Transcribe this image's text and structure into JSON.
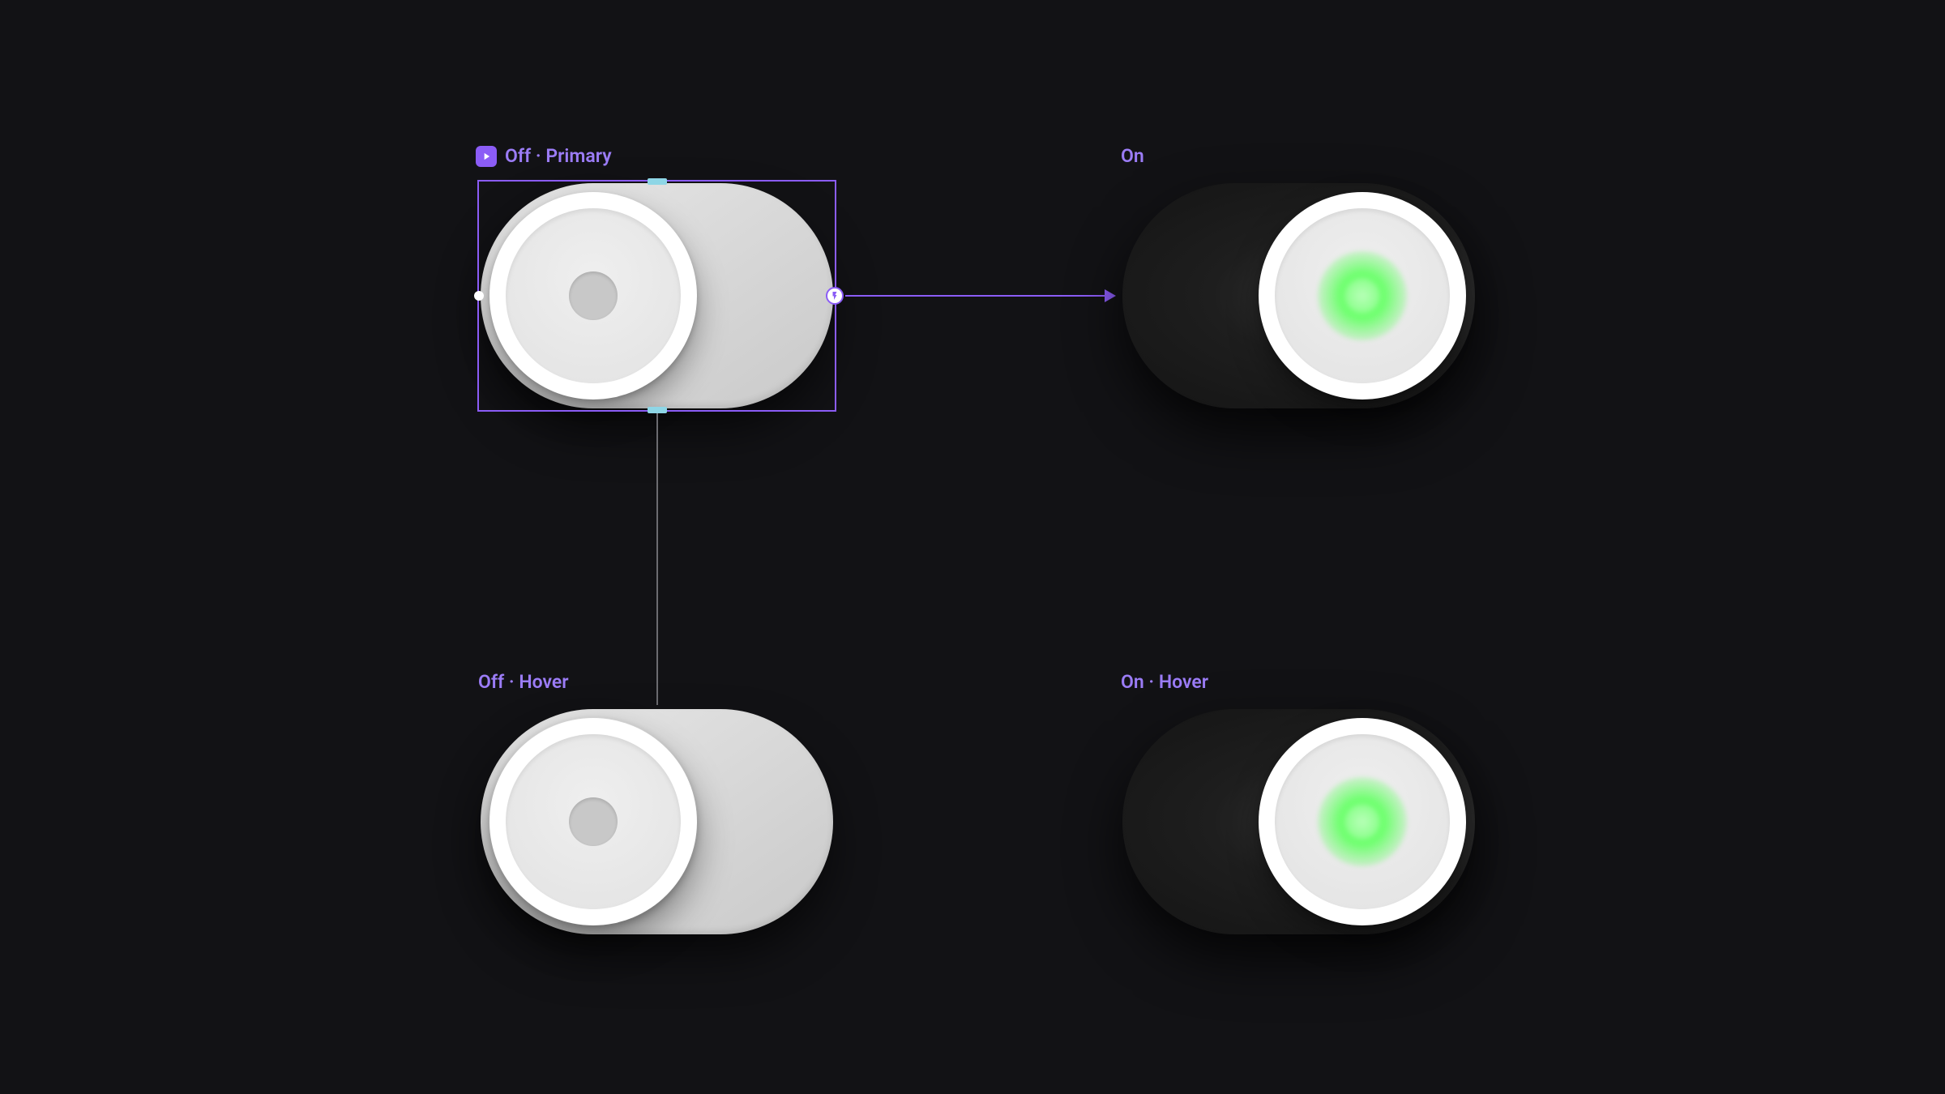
{
  "variants": {
    "off_primary": {
      "label": "Off · Primary"
    },
    "on": {
      "label": "On"
    },
    "off_hover": {
      "label": "Off · Hover"
    },
    "on_hover": {
      "label": "On · Hover"
    }
  },
  "colors": {
    "selection": "#8b5cf6",
    "label": "#9b7cf6",
    "on_indicator": "#6dff6d",
    "canvas_bg": "#121215"
  }
}
